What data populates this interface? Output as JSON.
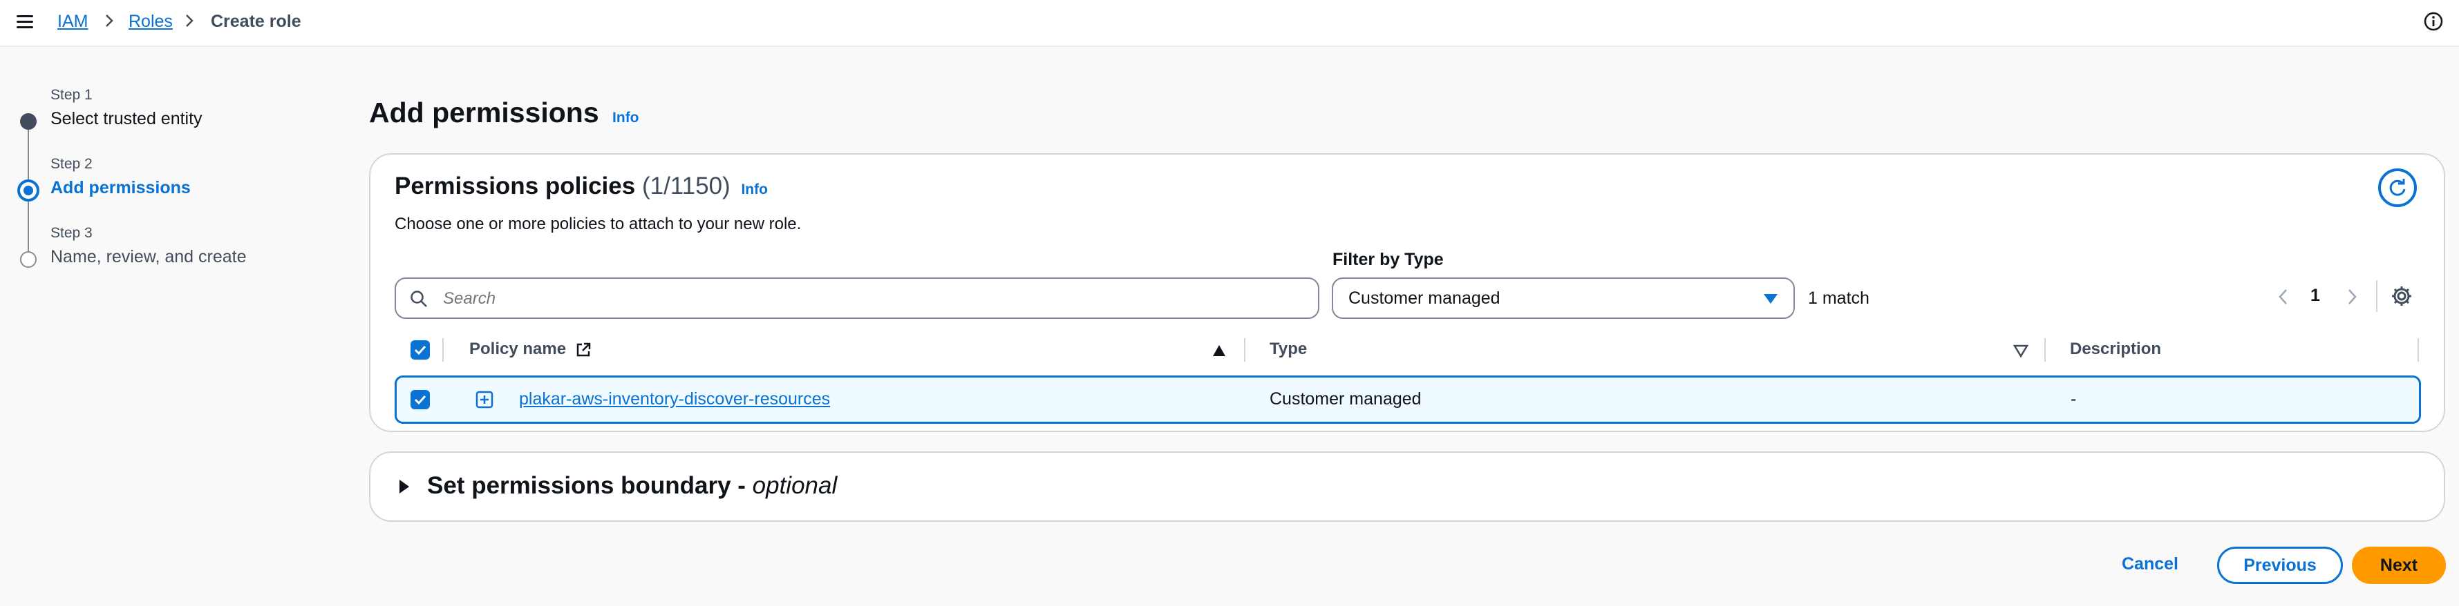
{
  "breadcrumb": {
    "items": [
      {
        "label": "IAM"
      },
      {
        "label": "Roles"
      },
      {
        "label": "Create role"
      }
    ]
  },
  "wizard": {
    "steps": [
      {
        "step": "Step 1",
        "title": "Select trusted entity",
        "status": "completed"
      },
      {
        "step": "Step 2",
        "title": "Add permissions",
        "status": "current"
      },
      {
        "step": "Step 3",
        "title": "Name, review, and create",
        "status": "upcoming"
      }
    ]
  },
  "page": {
    "title": "Add permissions",
    "info_label": "Info"
  },
  "policies": {
    "title": "Permissions policies",
    "count": "(1/1150)",
    "info_label": "Info",
    "description": "Choose one or more policies to attach to your new role.",
    "search_placeholder": "Search",
    "filter_label": "Filter by Type",
    "filter_value": "Customer managed",
    "match_text": "1 match",
    "current_page": "1",
    "columns": [
      "Policy name",
      "Type",
      "Description"
    ],
    "rows": [
      {
        "name": "plakar-aws-inventory-discover-resources",
        "type": "Customer managed",
        "description": "-",
        "selected": true
      }
    ]
  },
  "boundary": {
    "title": "Set permissions boundary - ",
    "optional": "optional"
  },
  "footer": {
    "cancel": "Cancel",
    "previous": "Previous",
    "next": "Next"
  },
  "colors": {
    "link": "#0972d3",
    "primary_button": "#ff9900",
    "selected_row_bg": "#f0fbff"
  }
}
